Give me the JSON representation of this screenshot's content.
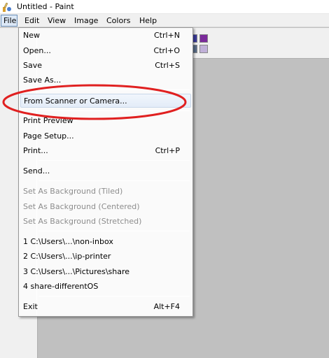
{
  "window": {
    "title": "Untitled - Paint"
  },
  "menubar": {
    "items": [
      {
        "label": "File"
      },
      {
        "label": "Edit"
      },
      {
        "label": "View"
      },
      {
        "label": "Image"
      },
      {
        "label": "Colors"
      },
      {
        "label": "Help"
      }
    ]
  },
  "palette": {
    "colors": [
      "#3b3b9e",
      "#7a2a9a",
      "#5a6e8a",
      "#c0b0d8"
    ]
  },
  "file_menu": {
    "items": [
      {
        "label": "New",
        "shortcut": "Ctrl+N",
        "enabled": true
      },
      {
        "label": "Open...",
        "shortcut": "Ctrl+O",
        "enabled": true
      },
      {
        "label": "Save",
        "shortcut": "Ctrl+S",
        "enabled": true
      },
      {
        "label": "Save As...",
        "shortcut": "",
        "enabled": true
      },
      {
        "label": "From Scanner or Camera...",
        "shortcut": "",
        "enabled": true,
        "highlighted": true
      },
      {
        "label": "Print Preview",
        "shortcut": "",
        "enabled": true
      },
      {
        "label": "Page Setup...",
        "shortcut": "",
        "enabled": true
      },
      {
        "label": "Print...",
        "shortcut": "Ctrl+P",
        "enabled": true
      },
      {
        "label": "Send...",
        "shortcut": "",
        "enabled": true
      },
      {
        "label": "Set As Background (Tiled)",
        "shortcut": "",
        "enabled": false
      },
      {
        "label": "Set As Background (Centered)",
        "shortcut": "",
        "enabled": false
      },
      {
        "label": "Set As Background (Stretched)",
        "shortcut": "",
        "enabled": false
      },
      {
        "label": "1 C:\\Users\\...\\non-inbox",
        "shortcut": "",
        "enabled": true
      },
      {
        "label": "2 C:\\Users\\...\\ip-printer",
        "shortcut": "",
        "enabled": true
      },
      {
        "label": "3 C:\\Users\\...\\Pictures\\share",
        "shortcut": "",
        "enabled": true
      },
      {
        "label": "4 share-differentOS",
        "shortcut": "",
        "enabled": true
      },
      {
        "label": "Exit",
        "shortcut": "Alt+F4",
        "enabled": true
      }
    ]
  },
  "annotation": {
    "color": "#e02020"
  }
}
